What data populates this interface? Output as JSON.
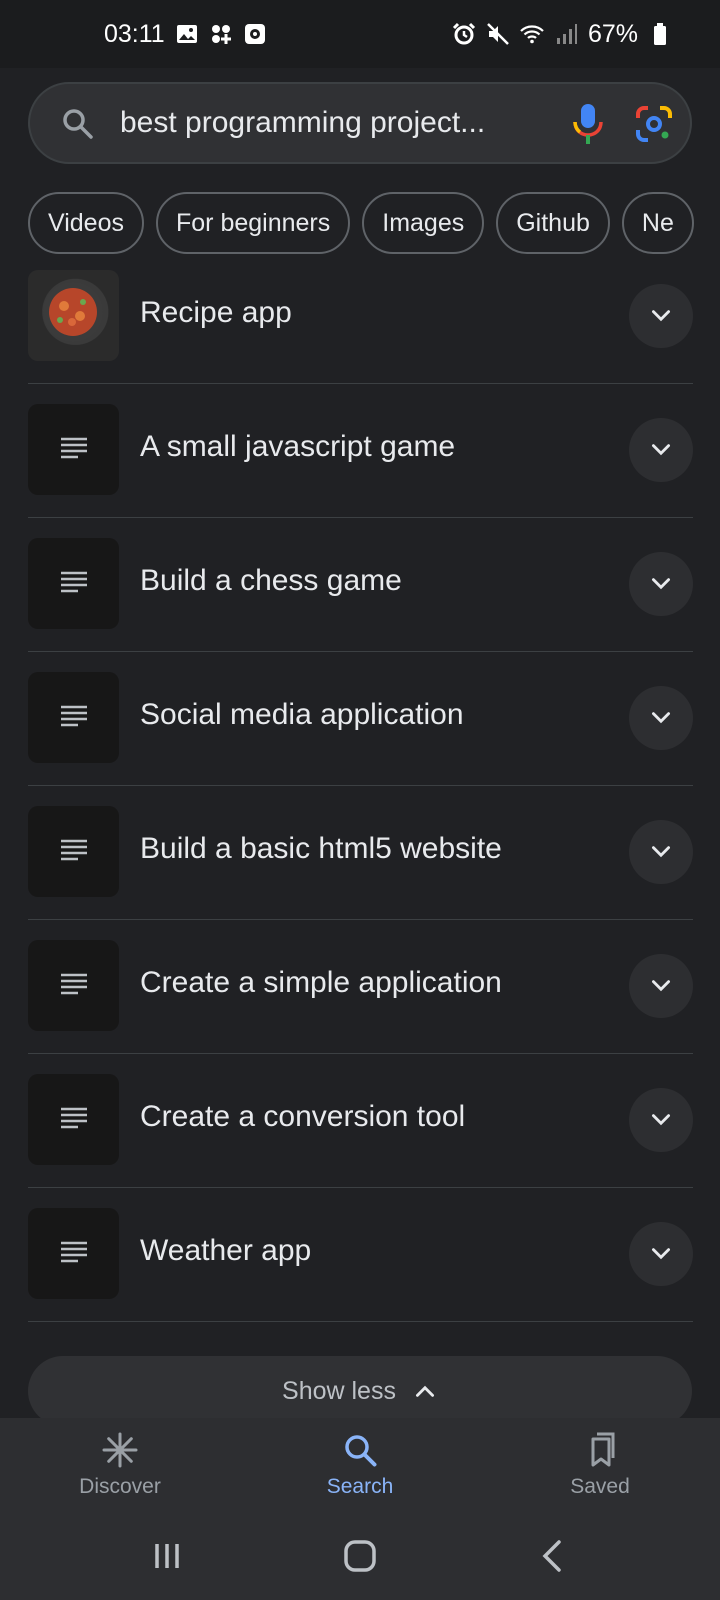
{
  "status_bar": {
    "time": "03:11",
    "battery": "67%",
    "left_icons": [
      "image-icon",
      "apps-icon",
      "screen-record-icon"
    ],
    "right_icons": [
      "alarm-icon",
      "mute-icon",
      "wifi-icon",
      "signal-icon",
      "battery-icon"
    ]
  },
  "search": {
    "query": "best programming project..."
  },
  "chips": [
    "Videos",
    "For beginners",
    "Images",
    "Github",
    "Ne"
  ],
  "results": [
    {
      "title": "Recipe app",
      "thumb": "food-image"
    },
    {
      "title": "A small javascript game",
      "thumb": "article-icon"
    },
    {
      "title": "Build a chess game",
      "thumb": "article-icon"
    },
    {
      "title": "Social media application",
      "thumb": "article-icon"
    },
    {
      "title": "Build a basic html5 website",
      "thumb": "article-icon"
    },
    {
      "title": "Create a simple application",
      "thumb": "article-icon"
    },
    {
      "title": "Create a conversion tool",
      "thumb": "article-icon"
    },
    {
      "title": "Weather app",
      "thumb": "article-icon"
    }
  ],
  "show_less": {
    "label": "Show less"
  },
  "bottom_nav": {
    "items": [
      {
        "label": "Discover",
        "icon": "discover-icon"
      },
      {
        "label": "Search",
        "icon": "search-icon",
        "active": true
      },
      {
        "label": "Saved",
        "icon": "saved-icon"
      }
    ]
  },
  "colors": {
    "background": "#202124",
    "accent": "#8ab4f8",
    "text": "#e8eaed"
  }
}
